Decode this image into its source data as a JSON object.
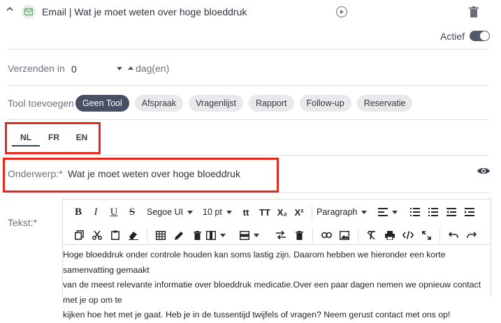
{
  "header": {
    "title": "Email | Wat je moet weten over hoge bloeddruk",
    "icons": [
      "chevron-up-icon",
      "mail-icon",
      "play-icon",
      "trash-icon"
    ],
    "accent": "#dff0e2"
  },
  "status": {
    "label": "Actief",
    "active": true
  },
  "send": {
    "label": "Verzenden in",
    "value": "0",
    "unit": "dag(en)"
  },
  "tools": {
    "label": "Tool toevoegen",
    "items": [
      "Geen Tool",
      "Afspraak",
      "Vragenlijst",
      "Rapport",
      "Follow-up",
      "Reservatie"
    ],
    "selected": "Geen Tool"
  },
  "languages": {
    "items": [
      "NL",
      "FR",
      "EN"
    ],
    "selected": "NL"
  },
  "subject": {
    "label": "Onderwerp:*",
    "value": "Wat je moet weten over hoge bloeddruk"
  },
  "text": {
    "label": "Tekst:*",
    "toolbar": {
      "font": "Segoe UI",
      "size": "10 pt",
      "block": "Paragraph",
      "glyphs": {
        "bold": "B",
        "italic": "I",
        "underline": "U",
        "strike": "S",
        "case1": "tt",
        "case2": "TT",
        "sub": "X₂",
        "sup": "X²"
      }
    },
    "body": [
      "Hoge bloeddruk onder controle houden kan soms lastig zijn. Daarom hebben we hieronder een korte samenvatting gemaakt",
      "van de meest relevante informatie over bloeddruk medicatie.Over een paar dagen nemen we opnieuw contact met je op om te",
      "kijken hoe het met je gaat. Heb je in de tussentijd twijfels of vragen? Neem gerust contact met ons op!"
    ]
  },
  "colors": {
    "highlight": "#e4291a",
    "pill_active": "#4a5063",
    "toggle": "#555a6a"
  }
}
